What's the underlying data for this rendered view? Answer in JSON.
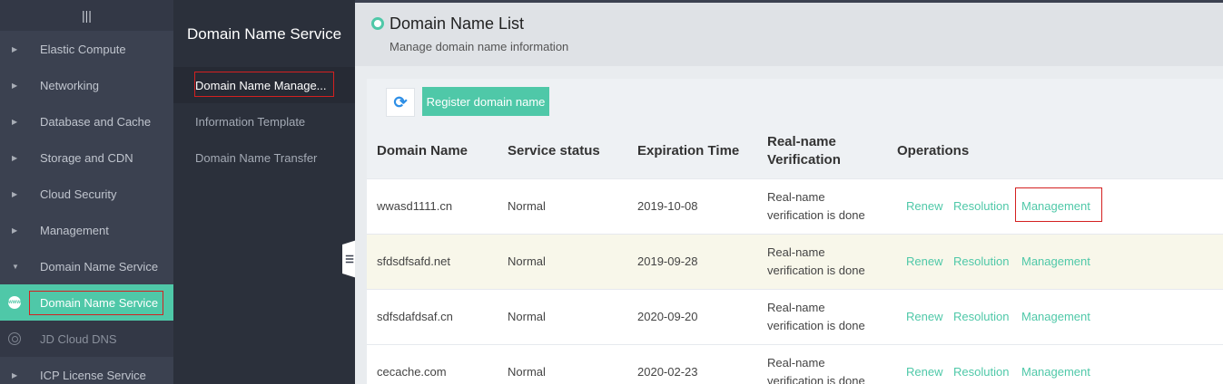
{
  "sidebar": {
    "menu_glyph": "|||",
    "items": [
      {
        "label": "Elastic Compute"
      },
      {
        "label": "Networking"
      },
      {
        "label": "Database and Cache"
      },
      {
        "label": "Storage and CDN"
      },
      {
        "label": "Cloud Security"
      },
      {
        "label": "Management"
      },
      {
        "label": "Domain Name Service"
      }
    ],
    "sub_items": [
      {
        "label": "Domain Name Service",
        "icon": "www-icon"
      },
      {
        "label": "JD Cloud DNS",
        "icon": "dns-icon"
      }
    ],
    "last_item": {
      "label": "ICP License Service"
    }
  },
  "midpanel": {
    "title": "Domain Name Service",
    "items": [
      {
        "label": "Domain Name Manage..."
      },
      {
        "label": "Information Template"
      },
      {
        "label": "Domain Name Transfer"
      }
    ]
  },
  "header": {
    "title": "Domain Name List",
    "subtitle": "Manage domain name information"
  },
  "toolbar": {
    "refresh_icon": "refresh-icon",
    "register_label": "Register domain name"
  },
  "table": {
    "columns": {
      "domain": "Domain Name",
      "status": "Service status",
      "expiration": "Expiration Time",
      "verification_line1": "Real-name",
      "verification_line2": "Verification",
      "operations": "Operations"
    },
    "rows": [
      {
        "domain": "wwasd1111.cn",
        "status": "Normal",
        "expiration": "2019-10-08",
        "verification_line1": "Real-name",
        "verification_line2": "verification is done"
      },
      {
        "domain": "sfdsdfsafd.net",
        "status": "Normal",
        "expiration": "2019-09-28",
        "verification_line1": "Real-name",
        "verification_line2": "verification is done"
      },
      {
        "domain": "sdfsdafdsaf.cn",
        "status": "Normal",
        "expiration": "2020-09-20",
        "verification_line1": "Real-name",
        "verification_line2": "verification is done"
      },
      {
        "domain": "cecache.com",
        "status": "Normal",
        "expiration": "2020-02-23",
        "verification_line1": "Real-name",
        "verification_line2": "verification is done"
      }
    ],
    "ops": {
      "renew": "Renew",
      "resolution": "Resolution",
      "management": "Management"
    }
  },
  "colors": {
    "accent": "#4fc8a8",
    "sidebar_bg": "#3b4150",
    "panel_bg": "#2b303b",
    "highlight_box": "#d42020",
    "row_alt": "#f8f7ea"
  }
}
